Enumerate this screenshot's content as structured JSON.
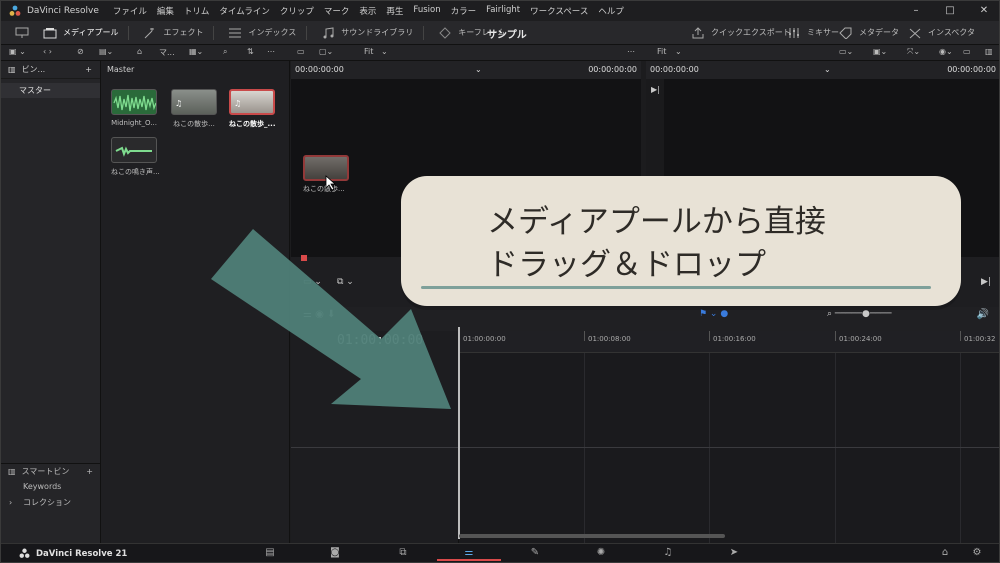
{
  "titlebar": {
    "app_name": "DaVinci Resolve",
    "menu": [
      "ファイル",
      "編集",
      "トリム",
      "タイムライン",
      "クリップ",
      "マーク",
      "表示",
      "再生",
      "Fusion",
      "カラー",
      "Fairlight",
      "ワークスペース",
      "ヘルプ"
    ],
    "controls": [
      "–",
      "□",
      "✕"
    ]
  },
  "toolbar": {
    "media_pool": "メディアプール",
    "effects": "エフェクト",
    "index": "インデックス",
    "sound_library": "サウンドライブラリ",
    "keyframe": "キーフレーム",
    "project_name": "サンプル",
    "quick_export": "クイックエクスポート",
    "mixer": "ミキサー",
    "metadata": "メタデータ",
    "inspector": "インスペクタ"
  },
  "subbar": {
    "pool_dropdown": "マ...",
    "fit_left": "Fit",
    "fit_right": "Fit"
  },
  "bins": {
    "header": "ビン...",
    "add": "+",
    "master": "マスター",
    "smart_bins": "スマートビン",
    "smart_add": "+",
    "keywords": "Keywords",
    "collections": "コレクション"
  },
  "pool": {
    "header": "Master",
    "clips": [
      {
        "name": "Midnight_O...",
        "kind": "audio"
      },
      {
        "name": "ねこの散歩...",
        "kind": "video"
      },
      {
        "name": "ねこの散歩_...",
        "kind": "video-selected"
      },
      {
        "name": "ねこの鳴き声...",
        "kind": "audio-single"
      }
    ]
  },
  "viewers": {
    "source_tc_left": "00:00:00:00",
    "source_tc_right": "00:00:00:00",
    "program_tc_left": "00:00:00:00",
    "program_tc_right": "00:00:00:00"
  },
  "drag_ghost": {
    "caption": "ねこの散歩..."
  },
  "timeline": {
    "timecode": "01:00:00:00",
    "ruler": [
      "01:00:00:00",
      "01:00:08:00",
      "01:00:16:00",
      "01:00:24:00",
      "01:00:32"
    ]
  },
  "pagebar": {
    "brand": "DaVinci Resolve 21",
    "pages": [
      "media-icon",
      "cut-icon",
      "edit-icon",
      "fusion-icon",
      "color-icon",
      "fairlight-icon",
      "deliver-icon"
    ],
    "active_page": "edit-icon"
  },
  "annotation": {
    "line1": "メディアプールから直接",
    "line2": "ドラッグ＆ドロップ"
  },
  "colors": {
    "accent": "#d94a4a",
    "arrow": "#4f7f78",
    "note_bg": "#e8e2d6"
  }
}
